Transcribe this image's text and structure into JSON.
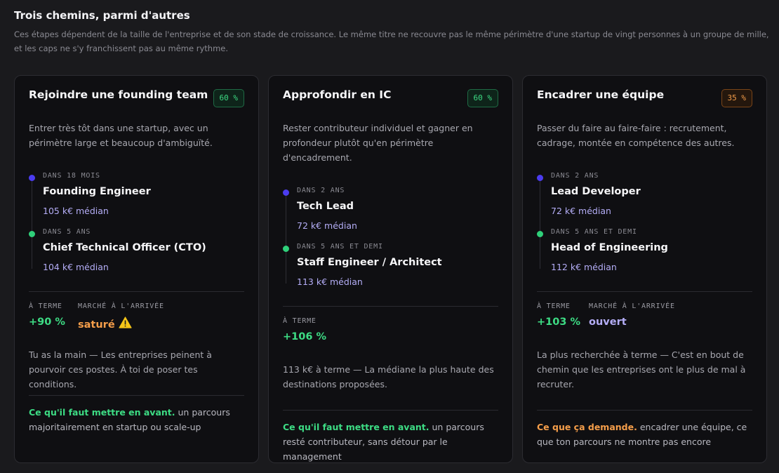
{
  "header": {
    "title": "Trois chemins, parmi d'autres",
    "subtitle": "Ces étapes dépendent de la taille de l'entreprise et de son stade de croissance. Le même titre ne recouvre pas le même périmètre d'une startup de vingt personnes à un groupe de mille, et les caps ne s'y franchissent pas au même rythme."
  },
  "colors": {
    "green": "#3ddc84",
    "orange": "#f59e4a",
    "violet": "#b4adf6",
    "blue_dot": "#4b3cf0"
  },
  "cards": [
    {
      "title": "Rejoindre une founding team",
      "badge": "60 %",
      "description": "Entrer très tôt dans une startup, avec un périmètre large et beaucoup d'ambiguïté.",
      "steps": [
        {
          "when": "DANS 18 MOIS",
          "role": "Founding Engineer",
          "salary": "105 k€ médian"
        },
        {
          "when": "DANS 5 ANS",
          "role": "Chief Technical Officer (CTO)",
          "salary": "104 k€ médian"
        }
      ],
      "term_label": "À TERME",
      "term_value": "+90 %",
      "market_label": "MARCHÉ À L'ARRIVÉE",
      "market_value": "saturé",
      "market_icon": "warning-icon",
      "note": "Tu as la main — Les entreprises peinent à pourvoir ces postes. À toi de poser tes conditions.",
      "highlight_label": "Ce qu'il faut mettre en avant.",
      "highlight_text": "un parcours majoritairement en startup ou scale-up"
    },
    {
      "title": "Approfondir en IC",
      "badge": "60 %",
      "description": "Rester contributeur individuel et gagner en profondeur plutôt qu'en périmètre d'encadrement.",
      "steps": [
        {
          "when": "DANS 2 ANS",
          "role": "Tech Lead",
          "salary": "72 k€ médian"
        },
        {
          "when": "DANS 5 ANS ET DEMI",
          "role": "Staff Engineer / Architect",
          "salary": "113 k€ médian"
        }
      ],
      "term_label": "À TERME",
      "term_value": "+106 %",
      "note": "113 k€ à terme — La médiane la plus haute des destinations proposées.",
      "highlight_label": "Ce qu'il faut mettre en avant.",
      "highlight_text": "un parcours resté contributeur, sans détour par le management"
    },
    {
      "title": "Encadrer une équipe",
      "badge": "35 %",
      "description": "Passer du faire au faire-faire : recrutement, cadrage, montée en compétence des autres.",
      "steps": [
        {
          "when": "DANS 2 ANS",
          "role": "Lead Developer",
          "salary": "72 k€ médian"
        },
        {
          "when": "DANS 5 ANS ET DEMI",
          "role": "Head of Engineering",
          "salary": "112 k€ médian"
        }
      ],
      "term_label": "À TERME",
      "term_value": "+103 %",
      "market_label": "MARCHÉ À L'ARRIVÉE",
      "market_value": "ouvert",
      "note": "La plus recherchée à terme — C'est en bout de chemin que les entreprises ont le plus de mal à recruter.",
      "highlight_label": "Ce que ça demande.",
      "highlight_text": "encadrer une équipe, ce que ton parcours ne montre pas encore"
    }
  ]
}
